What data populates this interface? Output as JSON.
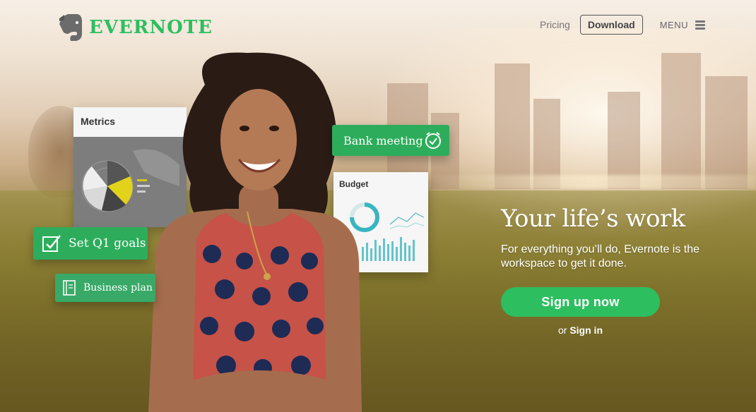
{
  "brand": {
    "name": "EVERNOTE",
    "color": "#2dbe60",
    "logo_icon": "elephant-icon"
  },
  "nav": {
    "pricing": "Pricing",
    "download": "Download",
    "menu": "MENU",
    "menu_icon": "hamburger-icon"
  },
  "cards": {
    "metrics": {
      "title": "Metrics"
    },
    "budget": {
      "title": "Budget"
    },
    "bank_meeting": {
      "label": "Bank meeting",
      "icon": "alarm-check-icon"
    },
    "goals": {
      "label": "Set Q1 goals",
      "icon": "checkbox-icon"
    },
    "business": {
      "label": "Business plan",
      "icon": "notebook-icon"
    }
  },
  "hero": {
    "title": "Your life’s work",
    "subtitle": "For everything you’ll do, Evernote is the workspace to get it done.",
    "cta": "Sign up now",
    "or_text": "or",
    "signin": "Sign in"
  }
}
